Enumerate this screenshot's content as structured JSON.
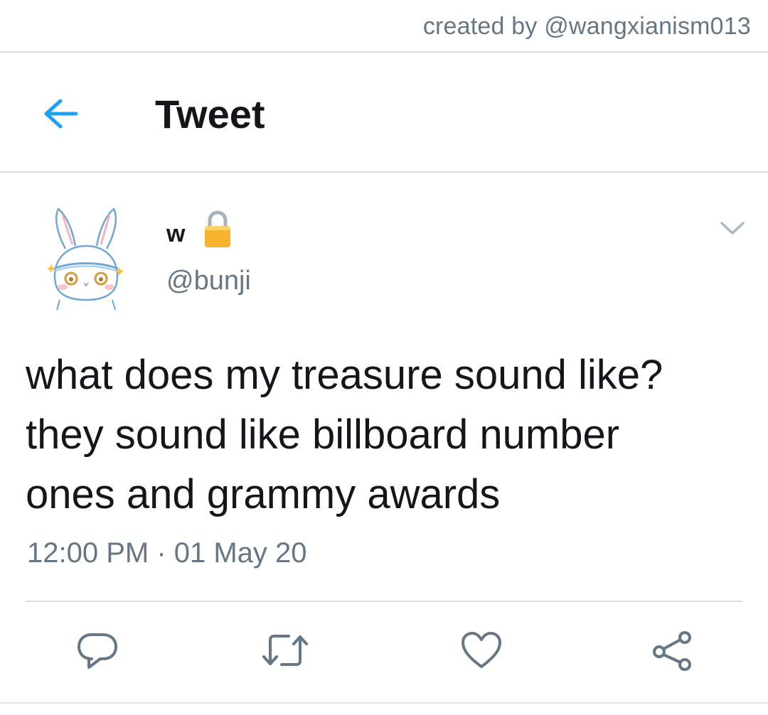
{
  "credit": "created by @wangxianism013",
  "header": {
    "title": "Tweet",
    "back_icon": "arrow-left-icon"
  },
  "tweet": {
    "display_name": "w",
    "username": "@bunji",
    "protected_icon": "lock-icon",
    "text_lines": [
      "what does my treasure sound like?",
      "they sound like billboard number",
      "ones and grammy awards"
    ],
    "timestamp": "12:00 PM · 01 May 20"
  },
  "actions": [
    "reply-icon",
    "retweet-icon",
    "like-icon",
    "share-icon"
  ],
  "colors": {
    "accent": "#1da1f2",
    "secondary_text": "#657786",
    "icon_gray": "#657786",
    "lock": "#f7b32b"
  }
}
